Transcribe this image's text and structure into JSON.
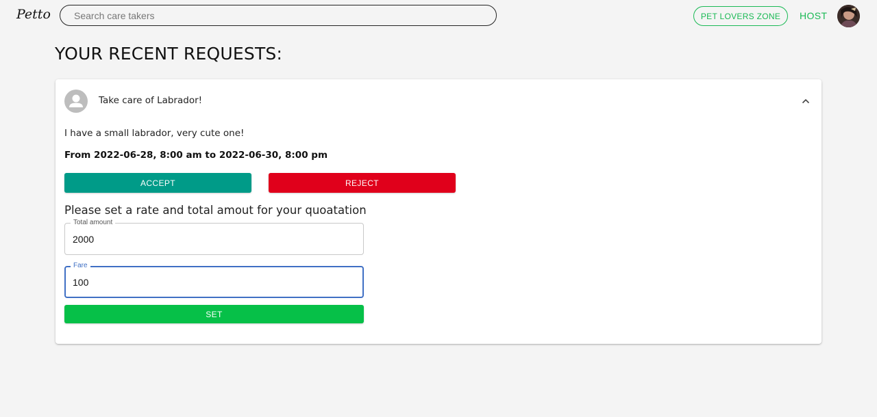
{
  "header": {
    "logo": "Petto",
    "search_placeholder": "Search care takers",
    "pet_lovers_zone_label": "PET LOVERS ZONE",
    "host_label": "HOST"
  },
  "main": {
    "title": "YOUR RECENT REQUESTS:"
  },
  "request": {
    "title": "Take care of Labrador!",
    "description": "I have a small labrador, very cute one!",
    "date_range": "From 2022-06-28, 8:00 am to 2022-06-30, 8:00 pm",
    "accept_label": "ACCEPT",
    "reject_label": "REJECT",
    "quotation_heading": "Please set a rate and total amout for your quoatation",
    "total_amount": {
      "label": "Total amount",
      "value": "2000"
    },
    "fare": {
      "label": "Fare",
      "value": "100"
    },
    "set_label": "SET"
  },
  "icons": {
    "card_avatar": "person-icon",
    "expand": "chevron-up-icon"
  },
  "colors": {
    "accent_green": "#19b954",
    "accept": "#009b88",
    "reject": "#e0001b",
    "set": "#06c048",
    "focus_blue": "#3f6fc4"
  }
}
